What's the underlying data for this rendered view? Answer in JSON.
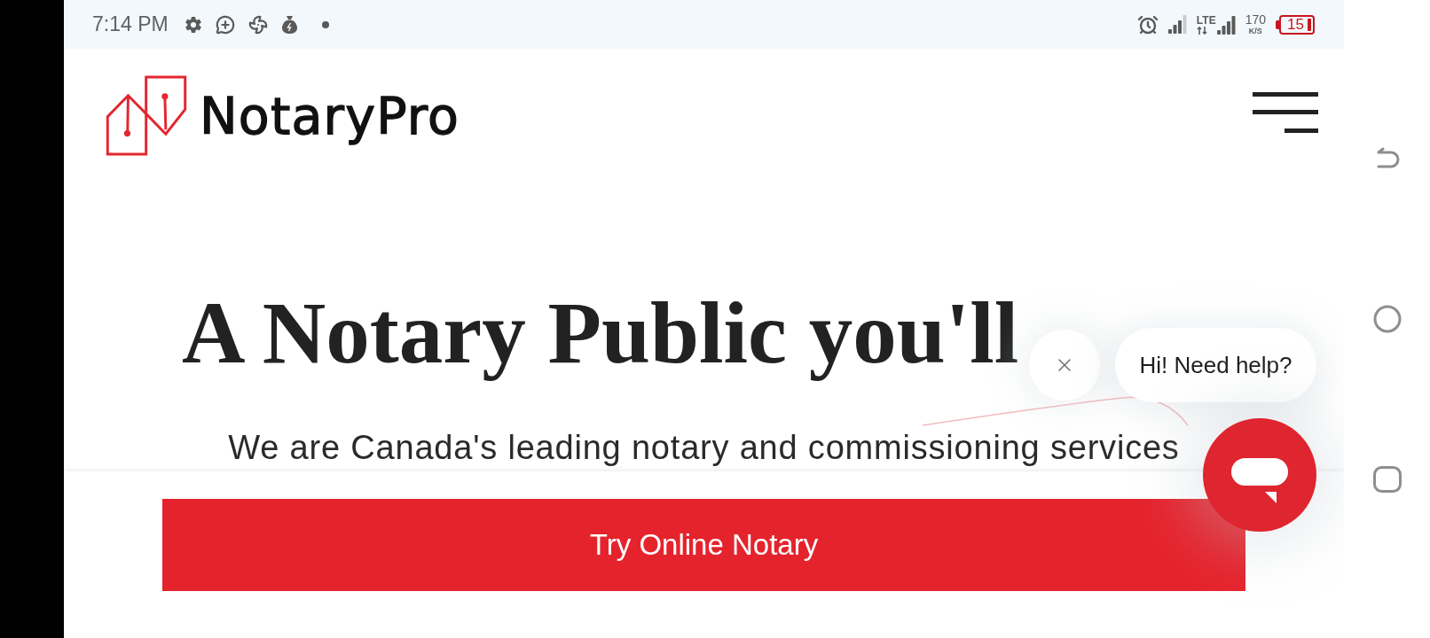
{
  "status_bar": {
    "time": "7:14 PM",
    "network": "LTE",
    "speed": "170",
    "speed_unit": "K/S",
    "battery": "15"
  },
  "header": {
    "logo_text": "NotaryPro"
  },
  "hero": {
    "headline": "A Notary Public you'll",
    "subtitle": "We are Canada's leading notary and commissioning services"
  },
  "cta_button": {
    "label": "Try Online Notary"
  },
  "chat_widget": {
    "greeting": "Hi! Need help?"
  }
}
